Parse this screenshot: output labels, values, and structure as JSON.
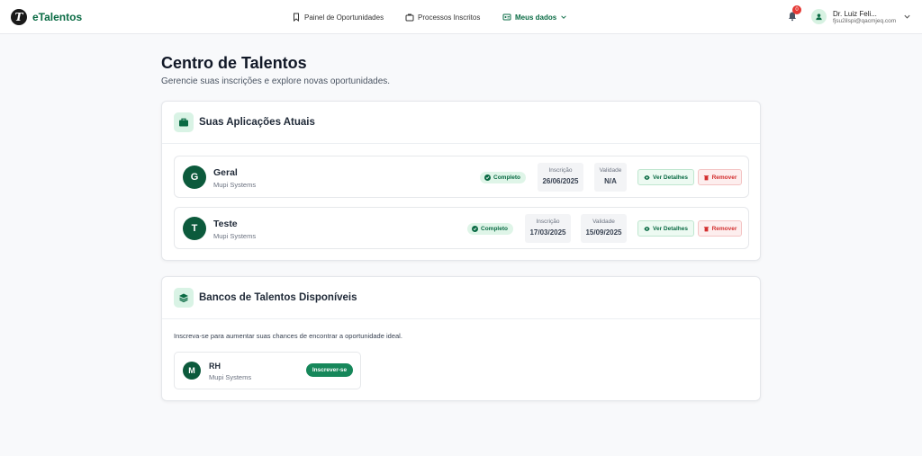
{
  "header": {
    "brand": "eTalentos",
    "brand_logo_letter": "T",
    "nav": [
      {
        "label": "Painel de Oportunidades",
        "icon": "bookmark-icon"
      },
      {
        "label": "Processos Inscritos",
        "icon": "briefcase-icon"
      },
      {
        "label": "Meus dados",
        "icon": "id-card-icon"
      }
    ],
    "notifications_count": "0",
    "user": {
      "name": "Dr. Luiz Feli...",
      "email": "fjsu2ilspi@qacmjeq.com"
    }
  },
  "page": {
    "title": "Centro de Talentos",
    "subtitle": "Gerencie suas inscrições e explore novas oportunidades."
  },
  "applications": {
    "title": "Suas Aplicações Atuais",
    "details_label": "Ver Detalhes",
    "remove_label": "Remover",
    "items": [
      {
        "initial": "G",
        "name": "Geral",
        "company": "Mupi Systems",
        "status": "Completo",
        "inscricao_label": "Inscrição",
        "inscricao": "26/06/2025",
        "validade_label": "Validade",
        "validade": "N/A"
      },
      {
        "initial": "T",
        "name": "Teste",
        "company": "Mupi Systems",
        "status": "Completo",
        "inscricao_label": "Inscrição",
        "inscricao": "17/03/2025",
        "validade_label": "Validade",
        "validade": "15/09/2025"
      }
    ]
  },
  "banks": {
    "title": "Bancos de Talentos Disponíveis",
    "intro": "Inscreva-se para aumentar suas chances de encontrar a oportunidade ideal.",
    "items": [
      {
        "initial": "M",
        "name": "RH",
        "company": "Mupi Systems",
        "action": "Inscrever-se"
      }
    ]
  },
  "colors": {
    "brand": "#0a6b44",
    "danger": "#d32f2f",
    "accent_bg": "#d9f3e5"
  }
}
